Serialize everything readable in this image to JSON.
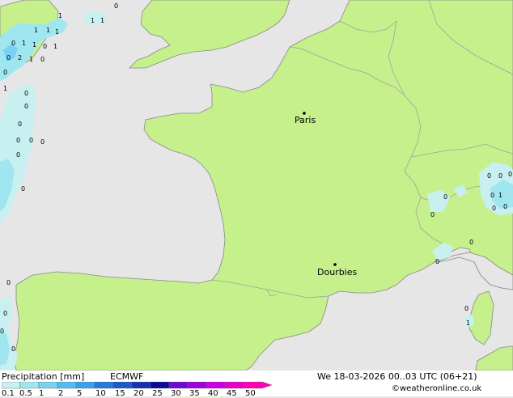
{
  "map": {
    "cities": [
      {
        "name": "Paris"
      },
      {
        "name": "Dourbies"
      }
    ],
    "rain_values": [
      "1",
      "1",
      "1",
      "0",
      "1",
      "1",
      "1",
      "0",
      "1",
      "1",
      "0",
      "1",
      "0",
      "2",
      "1",
      "0",
      "0",
      "1",
      "0",
      "0",
      "0",
      "0",
      "0",
      "0",
      "0",
      "0",
      "0",
      "0",
      "0",
      "0",
      "0",
      "0",
      "0",
      "0",
      "0",
      "1",
      "0",
      "0",
      "0",
      "0",
      "1",
      "0",
      "0"
    ]
  },
  "footer": {
    "left_title": "Precipitation [mm]",
    "model": "ECMWF",
    "datetime": "We 18-03-2026 00..03 UTC (06+21)",
    "credit": "©weatheronline.co.uk"
  },
  "legend": {
    "ticks": [
      "0.1",
      "0.5",
      "1",
      "2",
      "5",
      "10",
      "15",
      "20",
      "25",
      "30",
      "35",
      "40",
      "45",
      "50"
    ],
    "colors": [
      "#c8f0f0",
      "#a0e6f0",
      "#78d2f0",
      "#50bef0",
      "#3ca0f0",
      "#2878dc",
      "#1e5ac8",
      "#1432b4",
      "#0a0a96",
      "#6e0ad2",
      "#a000dc",
      "#c800e6",
      "#e600c8",
      "#ff00b4"
    ]
  },
  "colors": {
    "land": "#c6f08c",
    "sea": "#e6e6e6",
    "border": "#a0a0a0",
    "coast": "#888888",
    "rain_light": "#c8f0f0",
    "rain_mid": "#a0e6f0",
    "rain_strong": "#78d2f0"
  }
}
